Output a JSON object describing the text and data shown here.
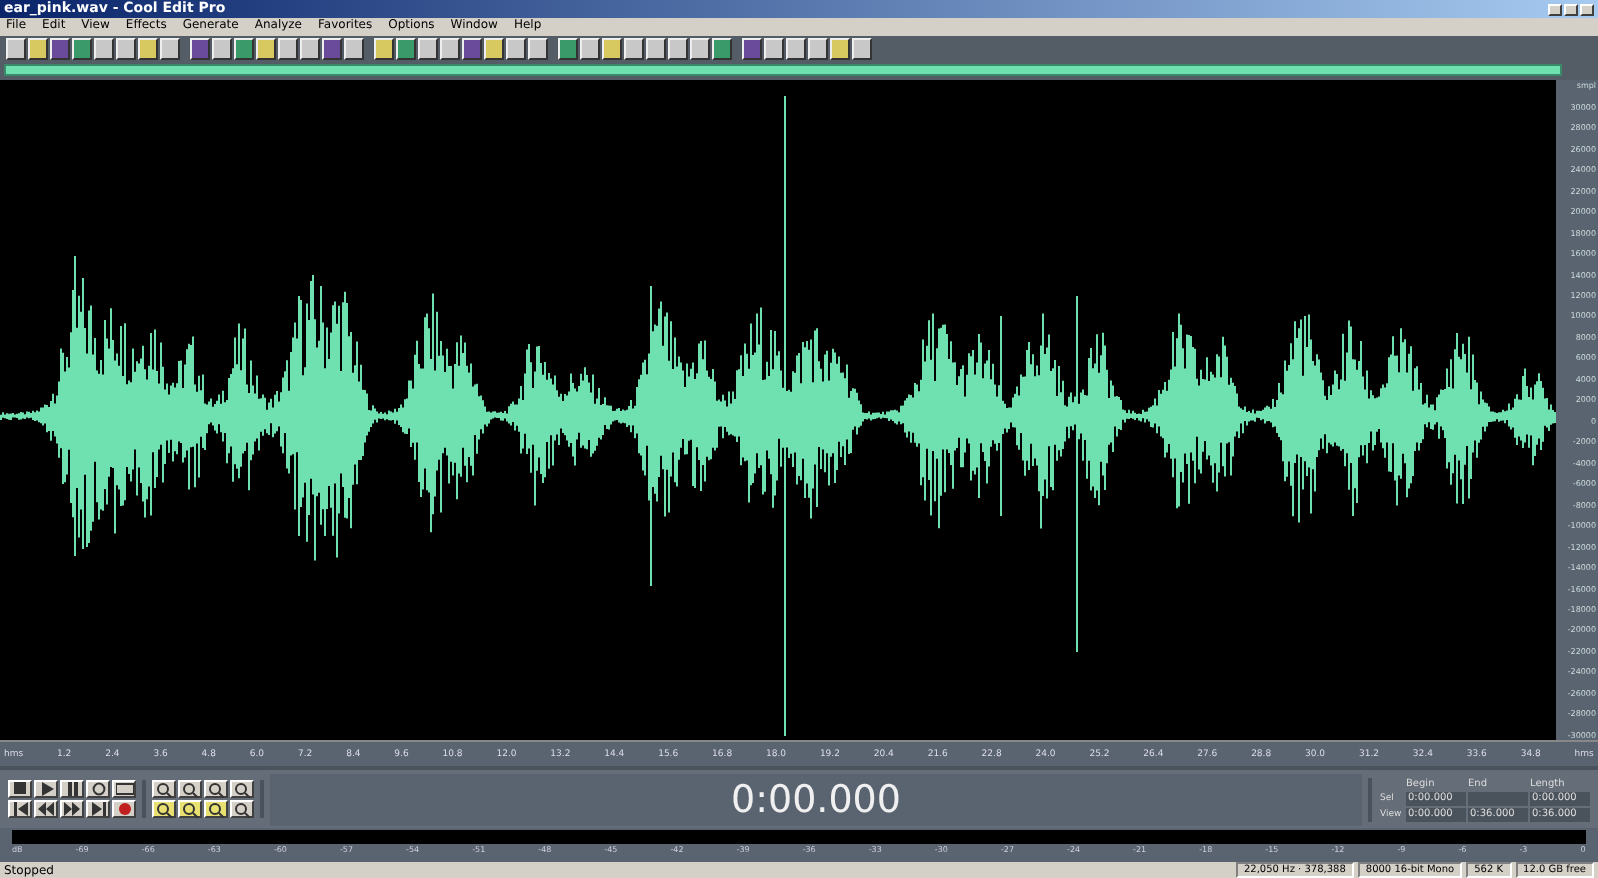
{
  "window": {
    "title": "ear_pink.wav - Cool Edit Pro"
  },
  "menu": [
    "File",
    "Edit",
    "View",
    "Effects",
    "Generate",
    "Analyze",
    "Favorites",
    "Options",
    "Window",
    "Help"
  ],
  "amplitude_ruler": [
    "smpl",
    "30000",
    "28000",
    "26000",
    "24000",
    "22000",
    "20000",
    "18000",
    "16000",
    "14000",
    "12000",
    "10000",
    "8000",
    "6000",
    "4000",
    "2000",
    "0",
    "-2000",
    "-4000",
    "-6000",
    "-8000",
    "-10000",
    "-12000",
    "-14000",
    "-16000",
    "-18000",
    "-20000",
    "-22000",
    "-24000",
    "-26000",
    "-28000",
    "-30000"
  ],
  "time_ruler": [
    "hms",
    "1.2",
    "2.4",
    "3.6",
    "4.8",
    "6.0",
    "7.2",
    "8.4",
    "9.6",
    "10.8",
    "12.0",
    "13.2",
    "14.4",
    "15.6",
    "16.8",
    "18.0",
    "19.2",
    "20.4",
    "21.6",
    "22.8",
    "24.0",
    "25.2",
    "26.4",
    "27.6",
    "28.8",
    "30.0",
    "31.2",
    "32.4",
    "33.6",
    "34.8",
    "hms"
  ],
  "time_display": "0:00.000",
  "selection": {
    "headers": [
      "Begin",
      "End",
      "Length"
    ],
    "rows": [
      {
        "label": "Sel",
        "begin": "0:00.000",
        "length": "0:00.000"
      },
      {
        "label": "View",
        "begin": "0:00.000",
        "end": "0:36.000",
        "length": "0:36.000"
      }
    ]
  },
  "level_meter": {
    "scale": [
      "dB",
      "-69",
      "-66",
      "-63",
      "-60",
      "-57",
      "-54",
      "-51",
      "-48",
      "-45",
      "-42",
      "-39",
      "-36",
      "-33",
      "-30",
      "-27",
      "-24",
      "-21",
      "-18",
      "-15",
      "-12",
      "-9",
      "-6",
      "-3",
      "0"
    ]
  },
  "status_bar": {
    "state": "Stopped",
    "fields": [
      "22,050 Hz · 378,388",
      "8000 16-bit Mono",
      "562 K",
      "12.0 GB free"
    ]
  }
}
